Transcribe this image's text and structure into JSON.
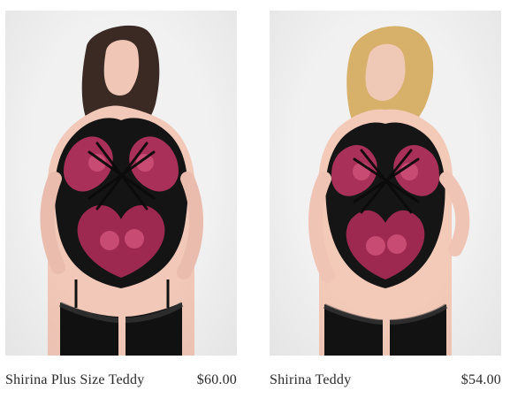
{
  "products": [
    {
      "name": "Shirina Plus Size Teddy",
      "price": "$60.00"
    },
    {
      "name": "Shirina Teddy",
      "price": "$54.00"
    }
  ]
}
